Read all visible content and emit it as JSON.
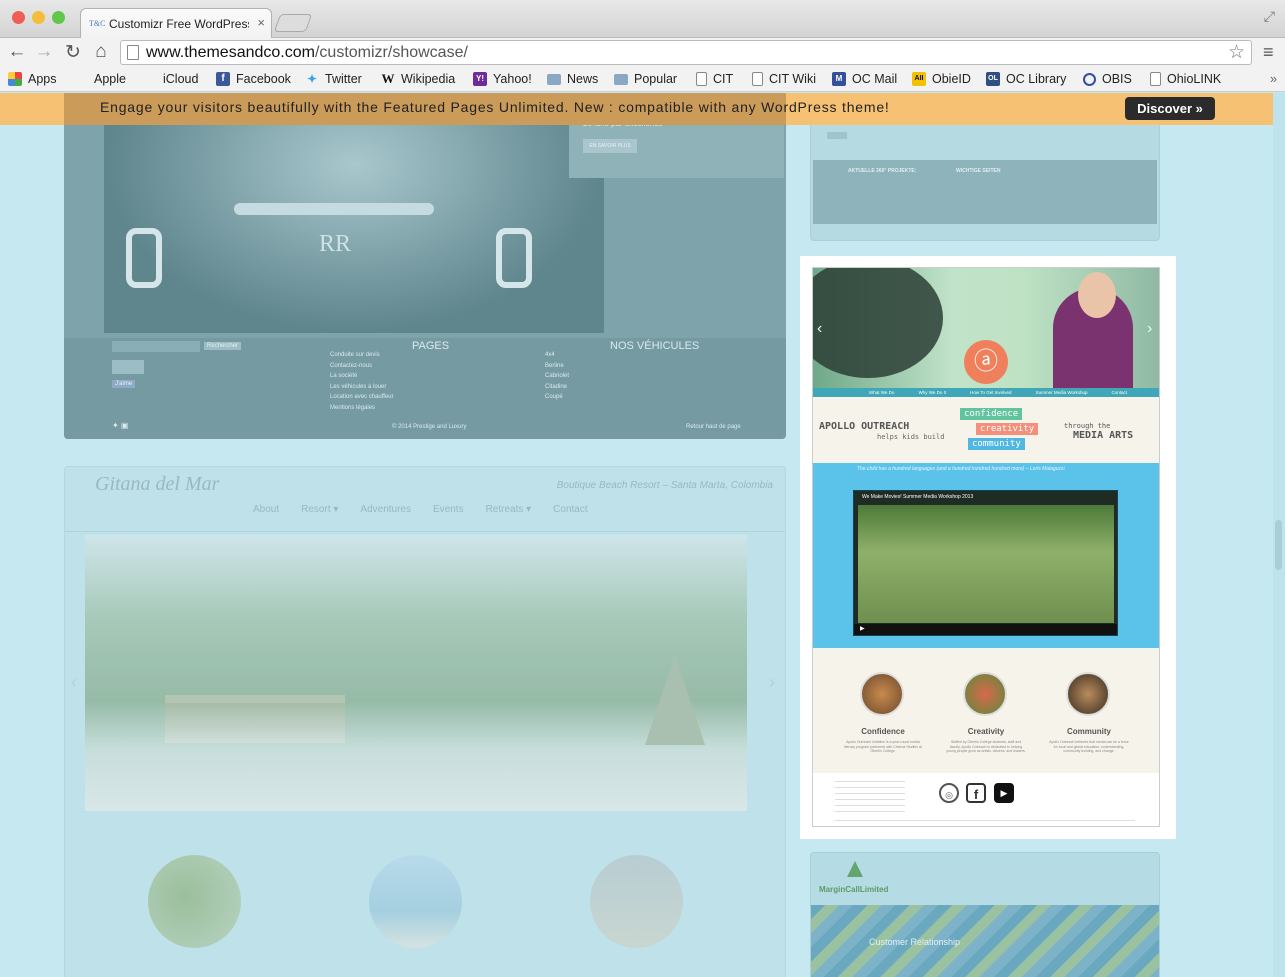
{
  "browser": {
    "tab_title": "Customizr Free WordPress",
    "tab_favicon": "T&C",
    "tab_close": "×",
    "url_host": "www.themesandco.com",
    "url_path": "/customizr/showcase/",
    "colors": {
      "close": "#ee5e56",
      "minimize": "#f6bd3b",
      "zoom": "#5fc84c"
    }
  },
  "bookmarks": [
    {
      "label": "Apps",
      "icon": "apps-grid-icon"
    },
    {
      "label": "Apple",
      "icon": "apple-icon"
    },
    {
      "label": "iCloud",
      "icon": "apple-icon"
    },
    {
      "label": "Facebook",
      "icon": "facebook-icon"
    },
    {
      "label": "Twitter",
      "icon": "twitter-icon"
    },
    {
      "label": "Wikipedia",
      "icon": "wikipedia-icon"
    },
    {
      "label": "Yahoo!",
      "icon": "yahoo-icon"
    },
    {
      "label": "News",
      "icon": "folder-icon"
    },
    {
      "label": "Popular",
      "icon": "folder-icon"
    },
    {
      "label": "CIT",
      "icon": "page-icon"
    },
    {
      "label": "CIT Wiki",
      "icon": "page-icon"
    },
    {
      "label": "OC Mail",
      "icon": "oc-mail-icon"
    },
    {
      "label": "ObieID",
      "icon": "obieid-icon"
    },
    {
      "label": "OC Library",
      "icon": "oc-library-icon"
    },
    {
      "label": "OBIS",
      "icon": "obis-icon"
    },
    {
      "label": "OhioLINK",
      "icon": "page-icon"
    }
  ],
  "promo": {
    "message": "Engage your visitors beautifully with the Featured Pages Unlimited. New : compatible with any WordPress theme!",
    "button": "Discover »"
  },
  "showcase": {
    "rolls": {
      "tagline": "Le luxe par excellence",
      "button": "EN SAVOIR PLUS",
      "search_button": "Rechercher",
      "like_button": "J'aime",
      "pages_title": "PAGES",
      "vehicles_title": "NOS VÉHICULES",
      "pages": [
        "Conduite sur devis",
        "Contactez-nous",
        "La société",
        "Les véhicules à louer",
        "Location avec chauffeur",
        "Mentions légales"
      ],
      "vehicles": [
        "4x4",
        "Berline",
        "Cabriolet",
        "Citadine",
        "Coupé"
      ],
      "copyright": "© 2014 Prestige and Luxury",
      "back_top": "Retour haut de page",
      "top_left_heading": "AKTUELLE 360° PROJEKTE:",
      "top_right_heading": "WICHTIGE SEITEN"
    },
    "gitana": {
      "logo": "Gitana del Mar",
      "tagline": "Boutique Beach Resort – Santa Marta, Colombia",
      "menu": [
        "About",
        "Resort ▾",
        "Adventures",
        "Events",
        "Retreats ▾",
        "Contact"
      ]
    },
    "apollo": {
      "title": "APOLLO OUTREACH",
      "subtitle": "helps kids build",
      "tags": [
        "confidence",
        "creativity",
        "community"
      ],
      "through": "through the",
      "media": "MEDIA ARTS",
      "nav": [
        "What We Do",
        "Why We Do It",
        "How To Get Involved",
        "Summer Media Workshop",
        "Contact"
      ],
      "quote": "The child has a hundred languages (and a hundred hundred hundred more) – Loris Malaguzzi",
      "video_title": "We Make Movies! Summer Media Workshop 2013",
      "pillars": [
        {
          "title": "Confidence",
          "text": "Apollo Outreach Initiative is a year-round media literacy program partnered with Cinema Studies at Oberlin College."
        },
        {
          "title": "Creativity",
          "text": "Staffed by Oberlin College students, staff and faculty, Apollo Outreach is dedicated to helping young people grow as artists, citizens, and leaders."
        },
        {
          "title": "Community",
          "text": "Apollo Outreach believes that media can be a force for local and global education, understanding, community building, and change."
        }
      ]
    },
    "margin": {
      "brand": "MarginCallLimited",
      "caption": "Customer Relationship"
    }
  }
}
